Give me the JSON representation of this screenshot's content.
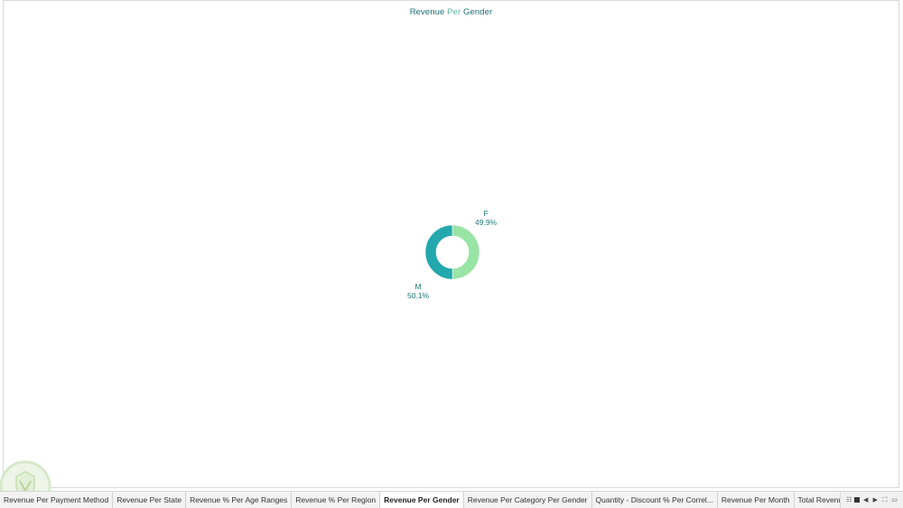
{
  "sheet": {
    "title_parts": [
      "Revenue",
      " Per",
      " Gender"
    ]
  },
  "colors": {
    "male": "#23a8ad",
    "female": "#98e4a5",
    "label": "#1e7a78"
  },
  "chart_data": {
    "type": "pie",
    "title": "Revenue Per Gender",
    "categories": [
      "M",
      "F"
    ],
    "values": [
      50.1,
      49.9
    ],
    "labels": [
      "50.1%",
      "49.9%"
    ],
    "style": "donut"
  },
  "tabs": [
    {
      "label": "Revenue Per Payment Method",
      "active": false
    },
    {
      "label": "Revenue Per State",
      "active": false
    },
    {
      "label": "Revenue % Per Age Ranges",
      "active": false
    },
    {
      "label": "Revenue % Per Region",
      "active": false
    },
    {
      "label": "Revenue Per Gender",
      "active": true
    },
    {
      "label": "Revenue Per Category Per Gender",
      "active": false
    },
    {
      "label": "Quantity - Discount % Per Correl...",
      "active": false
    },
    {
      "label": "Revenue Per Month",
      "active": false
    },
    {
      "label": "Total Revenue",
      "active": false
    },
    {
      "label": "Sales D",
      "active": false,
      "icon": "dashboard-grid-icon"
    }
  ],
  "controls": [
    "show-sheets-icon",
    "filmstrip-icon",
    "prev-sheet-icon",
    "next-sheet-icon",
    "fullscreen-icon",
    "present-icon"
  ]
}
